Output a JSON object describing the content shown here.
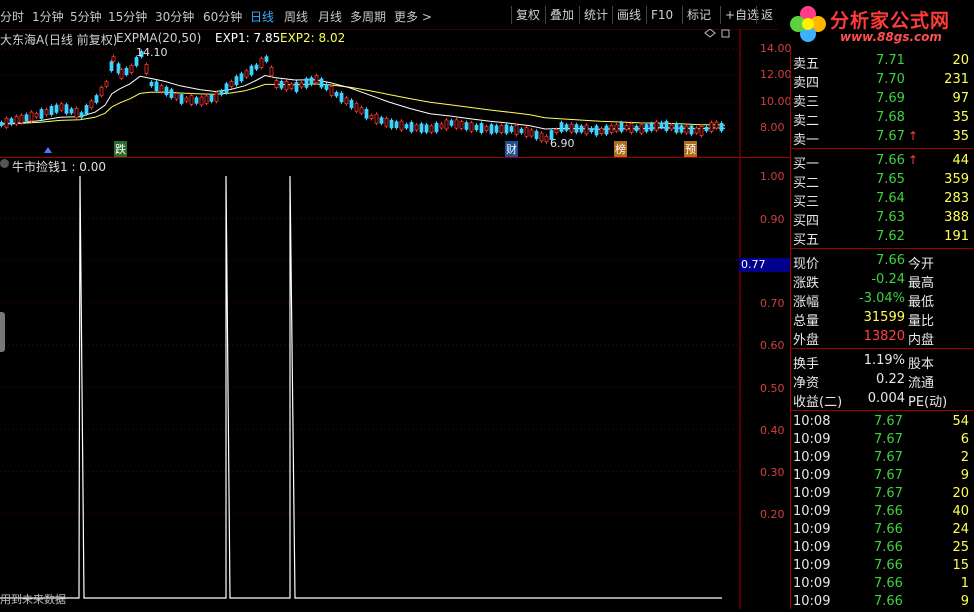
{
  "tabs": [
    {
      "label": "分时",
      "active": false
    },
    {
      "label": "1分钟",
      "active": false
    },
    {
      "label": "5分钟",
      "active": false
    },
    {
      "label": "15分钟",
      "active": false
    },
    {
      "label": "30分钟",
      "active": false
    },
    {
      "label": "60分钟",
      "active": false
    },
    {
      "label": "日线",
      "active": true
    },
    {
      "label": "周线",
      "active": false
    },
    {
      "label": "月线",
      "active": false
    },
    {
      "label": "多周期",
      "active": false
    },
    {
      "label": "更多 >",
      "active": false
    }
  ],
  "toolbar": [
    "复权",
    "叠加",
    "统计",
    "画线",
    "F10",
    "标记",
    "+自选",
    "返"
  ],
  "logo": {
    "title": "分析家公式网",
    "url": "www.88gs.com"
  },
  "main_chart": {
    "header_name": "大东海A(日线 前复权)",
    "indicator": "EXPMA(20,50)",
    "exp1": "EXP1: 7.85",
    "exp2": "EXP2: 8.02",
    "high_label": "14.10",
    "low_label": "6.90",
    "markers": [
      "跌",
      "财",
      "榜",
      "预"
    ],
    "axis": [
      "14.00",
      "12.00",
      "10.00",
      "8.00"
    ]
  },
  "sub_chart": {
    "header": "牛市捡钱1 : 0.00",
    "axis": [
      "1.00",
      "0.90",
      "0.70",
      "0.60",
      "0.50",
      "0.40",
      "0.30",
      "0.20"
    ],
    "cursor_value": "0.77",
    "footer": "用到未来数据"
  },
  "chart_data": {
    "type": "line",
    "title": "牛市捡钱1",
    "ylim": [
      0,
      1
    ],
    "series": [
      {
        "name": "牛市捡钱1",
        "values": [
          0,
          1,
          0,
          0,
          1,
          0,
          1,
          0,
          0
        ]
      }
    ]
  },
  "order_book": {
    "asks": [
      {
        "label": "卖五",
        "price": "7.71",
        "vol": "20",
        "flag": ""
      },
      {
        "label": "卖四",
        "price": "7.70",
        "vol": "231",
        "flag": ""
      },
      {
        "label": "卖三",
        "price": "7.69",
        "vol": "97",
        "flag": ""
      },
      {
        "label": "卖二",
        "price": "7.68",
        "vol": "35",
        "flag": ""
      },
      {
        "label": "卖一",
        "price": "7.67",
        "vol": "35",
        "flag": "↑"
      }
    ],
    "bids": [
      {
        "label": "买一",
        "price": "7.66",
        "vol": "44",
        "flag": "↑"
      },
      {
        "label": "买二",
        "price": "7.65",
        "vol": "359",
        "flag": ""
      },
      {
        "label": "买三",
        "price": "7.64",
        "vol": "283",
        "flag": ""
      },
      {
        "label": "买四",
        "price": "7.63",
        "vol": "388",
        "flag": ""
      },
      {
        "label": "买五",
        "price": "7.62",
        "vol": "191",
        "flag": ""
      }
    ]
  },
  "quote": [
    {
      "l1": "现价",
      "v1": "7.66",
      "c1": "cgreen",
      "l2": "今开"
    },
    {
      "l1": "涨跌",
      "v1": "-0.24",
      "c1": "cgreen",
      "l2": "最高"
    },
    {
      "l1": "涨幅",
      "v1": "-3.04%",
      "c1": "cgreen",
      "l2": "最低"
    },
    {
      "l1": "总量",
      "v1": "31599",
      "c1": "cyellow",
      "l2": "量比"
    },
    {
      "l1": "外盘",
      "v1": "13820",
      "c1": "cred",
      "l2": "内盘"
    }
  ],
  "quote2": [
    {
      "l1": "换手",
      "v1": "1.19%",
      "l2": "股本"
    },
    {
      "l1": "净资",
      "v1": "0.22",
      "l2": "流通"
    },
    {
      "l1": "收益(二)",
      "v1": "0.004",
      "l2": "PE(动)"
    }
  ],
  "ticks": [
    {
      "time": "10:08",
      "price": "7.67",
      "vol": "54"
    },
    {
      "time": "10:09",
      "price": "7.67",
      "vol": "6"
    },
    {
      "time": "10:09",
      "price": "7.67",
      "vol": "2"
    },
    {
      "time": "10:09",
      "price": "7.67",
      "vol": "9"
    },
    {
      "time": "10:09",
      "price": "7.67",
      "vol": "20"
    },
    {
      "time": "10:09",
      "price": "7.66",
      "vol": "40"
    },
    {
      "time": "10:09",
      "price": "7.66",
      "vol": "24"
    },
    {
      "time": "10:09",
      "price": "7.66",
      "vol": "25"
    },
    {
      "time": "10:09",
      "price": "7.66",
      "vol": "15"
    },
    {
      "time": "10:09",
      "price": "7.66",
      "vol": "1"
    },
    {
      "time": "10:09",
      "price": "7.66",
      "vol": "9"
    }
  ],
  "colors": {
    "up": "#ff3030",
    "down": "#3fd2ff",
    "exp1": "#ffffff",
    "exp2": "#ffff55",
    "grid": "#8a0000"
  }
}
